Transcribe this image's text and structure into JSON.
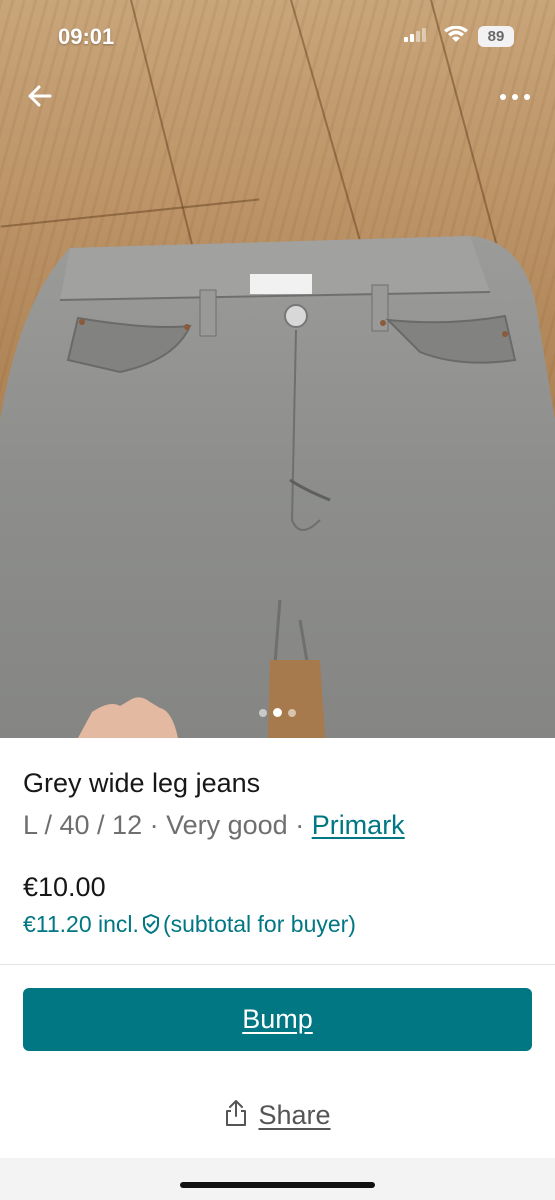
{
  "status_bar": {
    "time": "09:01",
    "battery": "89"
  },
  "gallery": {
    "image_alt": "Grey wide leg jeans laid flat on a wooden floor",
    "page_count": 3,
    "active_index": 1
  },
  "item": {
    "title": "Grey wide leg jeans",
    "size": "L / 40 / 12",
    "separator": " · ",
    "condition": "Very good",
    "brand": "Primark",
    "price": "€10.00",
    "price_incl": "€11.20 incl.",
    "price_note": "(subtotal for buyer)"
  },
  "actions": {
    "bump_label": "Bump",
    "share_label": "Share"
  },
  "icons": {
    "back": "arrow-left-icon",
    "more": "more-horizontal-icon",
    "shield": "shield-check-icon",
    "share": "share-icon"
  },
  "colors": {
    "accent": "#007782",
    "text": "#171717",
    "muted": "#6f6f6f"
  }
}
